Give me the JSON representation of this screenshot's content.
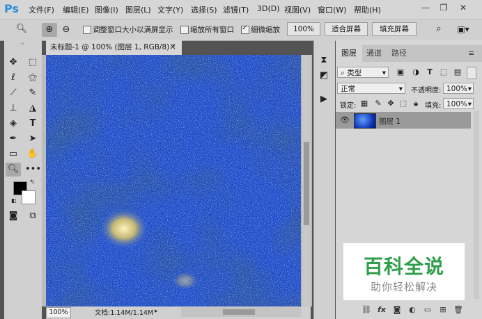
{
  "app": {
    "logo": "Ps"
  },
  "menu": [
    "文件(F)",
    "编辑(E)",
    "图像(I)",
    "图层(L)",
    "文字(Y)",
    "选择(S)",
    "滤镜(T)",
    "3D(D)",
    "视图(V)",
    "窗口(W)",
    "帮助(H)"
  ],
  "window_controls": {
    "minimize": "—",
    "restore": "❐",
    "close": "✕"
  },
  "options": {
    "resize_windows_label": "调整窗口大小以满屏显示",
    "zoom_all_label": "缩放所有窗口",
    "scrubby_zoom_label": "细微缩放",
    "scrubby_zoom_checked": true,
    "zoom_value": "100%",
    "fit_screen_label": "适合屏幕",
    "fill_screen_label": "填充屏幕"
  },
  "document": {
    "tab_title": "未标题-1 @ 100% (图层 1, RGB/8) *",
    "tab_close": "×",
    "zoom": "100%",
    "doc_info": "文档:1.14M/1.14M"
  },
  "layers_panel": {
    "tabs": [
      "图层",
      "通道",
      "路径"
    ],
    "active_tab": "图层",
    "filter_kind": "类型",
    "blend_mode": "正常",
    "opacity_label": "不透明度:",
    "opacity_value": "100%",
    "lock_label": "锁定:",
    "fill_label": "填充:",
    "fill_value": "100%",
    "layer_name": "图层 1"
  },
  "watermark": {
    "title": "百科全说",
    "subtitle": "助你轻松解决"
  },
  "colors": {
    "accent": "#2f8fd8",
    "watermark_green": "#2e9e4a",
    "foreground": "#000000",
    "background": "#ffffff"
  }
}
